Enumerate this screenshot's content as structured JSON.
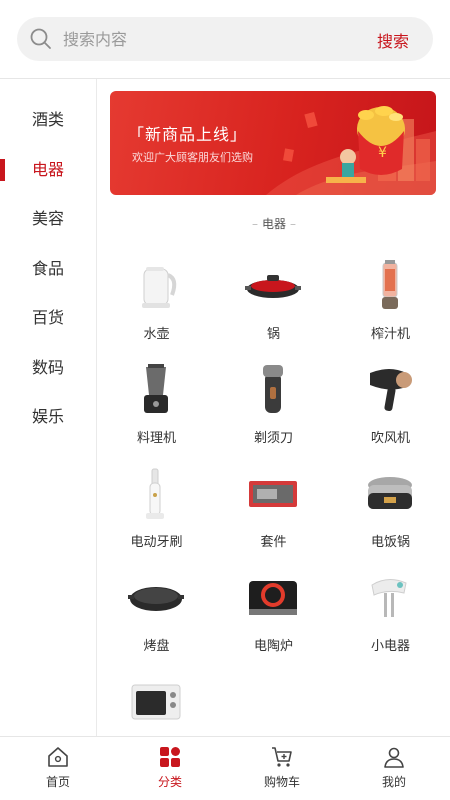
{
  "search": {
    "placeholder": "搜索内容",
    "button_label": "搜索"
  },
  "sidebar": {
    "items": [
      {
        "label": "酒类"
      },
      {
        "label": "电器",
        "active": true
      },
      {
        "label": "美容"
      },
      {
        "label": "食品"
      },
      {
        "label": "百货"
      },
      {
        "label": "数码"
      },
      {
        "label": "娱乐"
      }
    ]
  },
  "banner": {
    "title": "「新商品上线」",
    "subtitle": "欢迎广大顾客朋友们选购",
    "accent_color": "#d8231f"
  },
  "section": {
    "title": "电器"
  },
  "products": [
    {
      "label": "水壶",
      "icon": "kettle-icon"
    },
    {
      "label": "锅",
      "icon": "grill-pan-icon"
    },
    {
      "label": "榨汁机",
      "icon": "juicer-icon"
    },
    {
      "label": "料理机",
      "icon": "blender-icon"
    },
    {
      "label": "剃须刀",
      "icon": "shaver-icon"
    },
    {
      "label": "吹风机",
      "icon": "hair-dryer-icon"
    },
    {
      "label": "电动牙刷",
      "icon": "electric-toothbrush-icon"
    },
    {
      "label": "套件",
      "icon": "kit-icon"
    },
    {
      "label": "电饭锅",
      "icon": "rice-cooker-icon"
    },
    {
      "label": "烤盘",
      "icon": "baking-pan-icon"
    },
    {
      "label": "电陶炉",
      "icon": "ceramic-stove-icon"
    },
    {
      "label": "小电器",
      "icon": "hand-mixer-icon"
    },
    {
      "label": "",
      "icon": "oven-icon"
    }
  ],
  "tabbar": {
    "items": [
      {
        "label": "首页",
        "icon": "home-icon"
      },
      {
        "label": "分类",
        "icon": "category-icon",
        "active": true
      },
      {
        "label": "购物车",
        "icon": "cart-icon"
      },
      {
        "label": "我的",
        "icon": "user-icon"
      }
    ]
  },
  "colors": {
    "brand": "#c8161d",
    "text": "#333333",
    "muted": "#9a9a9a"
  }
}
